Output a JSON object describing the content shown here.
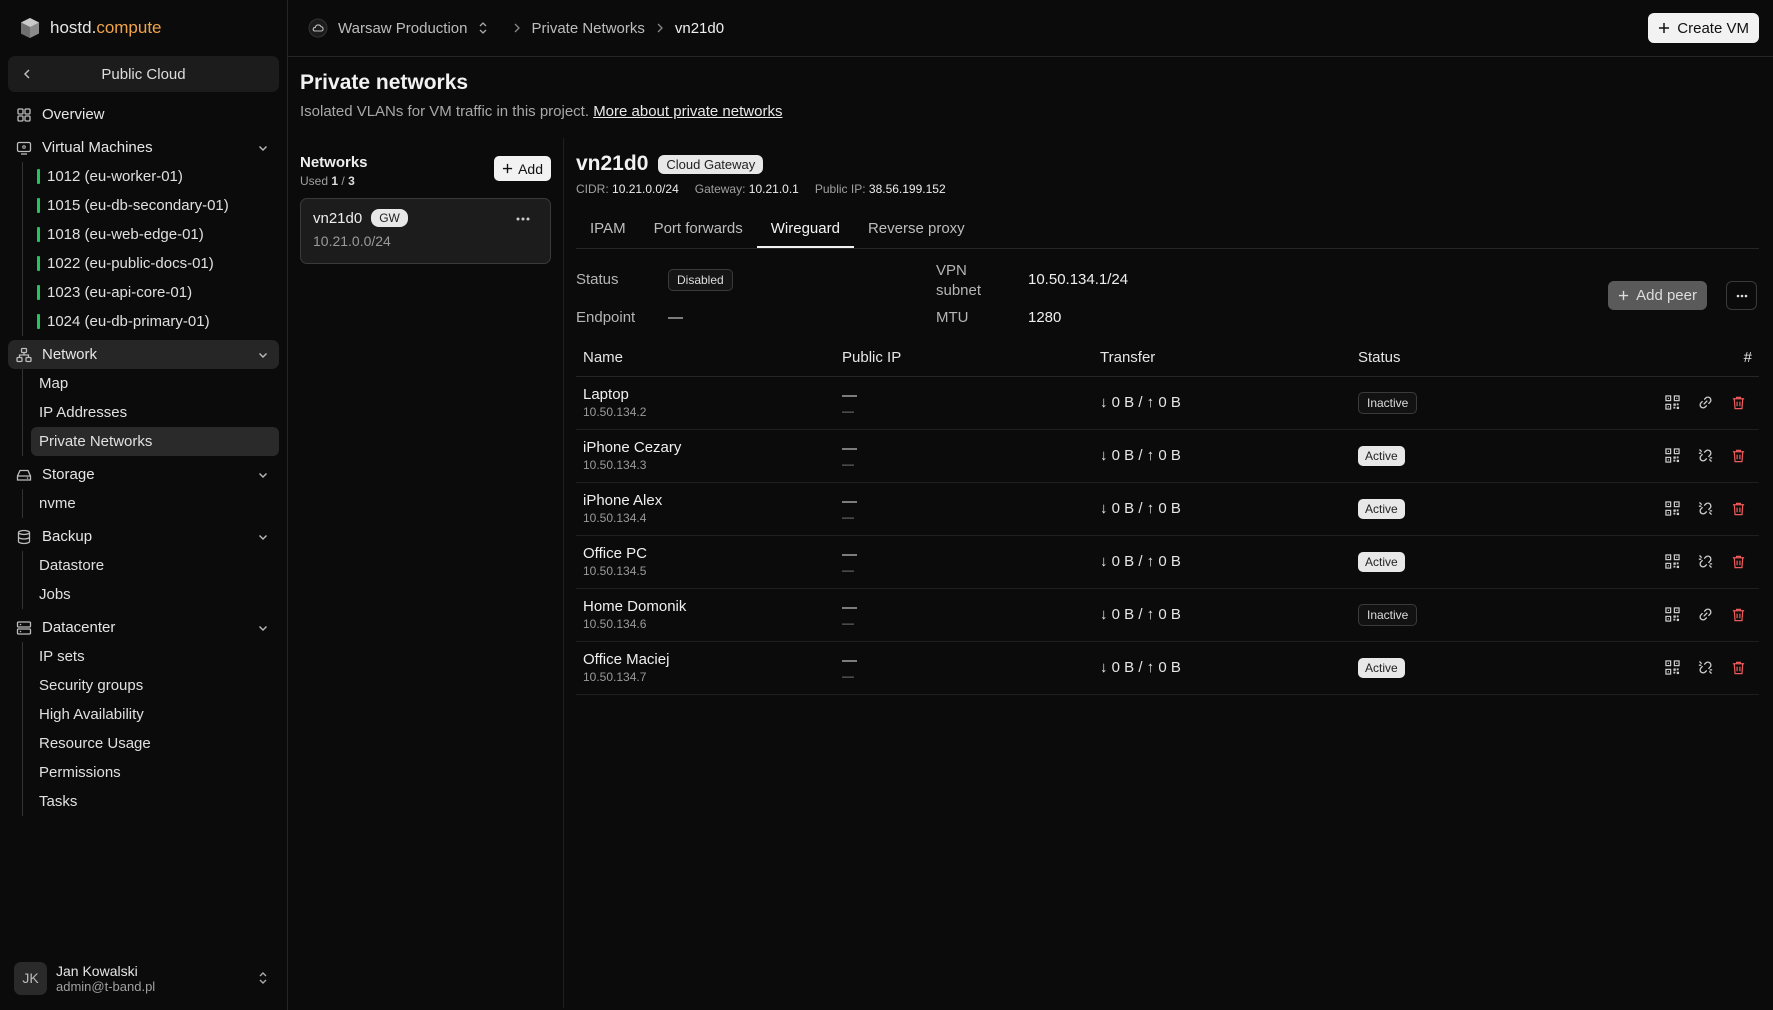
{
  "brand": {
    "name": "hostd.",
    "accent": "compute"
  },
  "sidebar": {
    "back_label": "Public Cloud",
    "overview": "Overview",
    "vm_group": "Virtual Machines",
    "vms": [
      "1012 (eu-worker-01)",
      "1015 (eu-db-secondary-01)",
      "1018 (eu-web-edge-01)",
      "1022 (eu-public-docs-01)",
      "1023 (eu-api-core-01)",
      "1024 (eu-db-primary-01)"
    ],
    "network_group": "Network",
    "network_items": [
      "Map",
      "IP Addresses",
      "Private Networks"
    ],
    "storage_group": "Storage",
    "storage_items": [
      "nvme"
    ],
    "backup_group": "Backup",
    "backup_items": [
      "Datastore",
      "Jobs"
    ],
    "datacenter_group": "Datacenter",
    "datacenter_items": [
      "IP sets",
      "Security groups",
      "High Availability",
      "Resource Usage",
      "Permissions",
      "Tasks"
    ]
  },
  "user": {
    "initials": "JK",
    "name": "Jan Kowalski",
    "email": "admin@t-band.pl"
  },
  "topbar": {
    "project": "Warsaw Production",
    "crumb1": "Private Networks",
    "crumb2": "vn21d0",
    "create_label": "Create VM"
  },
  "page": {
    "title": "Private networks",
    "subtitle": "Isolated VLANs for VM traffic in this project.",
    "link": "More about private networks"
  },
  "networks": {
    "title": "Networks",
    "used_label": "Used",
    "used": "1",
    "total": "3",
    "add_label": "Add",
    "card": {
      "name": "vn21d0",
      "badge": "GW",
      "cidr": "10.21.0.0/24"
    }
  },
  "detail": {
    "name": "vn21d0",
    "badge": "Cloud Gateway",
    "cidr_label": "CIDR:",
    "cidr": "10.21.0.0/24",
    "gateway_label": "Gateway:",
    "gateway": "10.21.0.1",
    "public_ip_label": "Public IP:",
    "public_ip": "38.56.199.152",
    "tabs": [
      "IPAM",
      "Port forwards",
      "Wireguard",
      "Reverse proxy"
    ],
    "active_tab": "Wireguard"
  },
  "wireguard": {
    "status_label": "Status",
    "status": "Disabled",
    "endpoint_label": "Endpoint",
    "endpoint": "—",
    "vpn_label_1": "VPN",
    "vpn_label_2": "subnet",
    "vpn_subnet": "10.50.134.1/24",
    "mtu_label": "MTU",
    "mtu": "1280",
    "add_peer_label": "Add peer",
    "columns": [
      "Name",
      "Public IP",
      "Transfer",
      "Status",
      "#"
    ],
    "peers": [
      {
        "name": "Laptop",
        "ip": "10.50.134.2",
        "public_ip": "—",
        "public_ip_sub": "—",
        "transfer": "↓ 0 B / ↑ 0 B",
        "status": "Inactive"
      },
      {
        "name": "iPhone Cezary",
        "ip": "10.50.134.3",
        "public_ip": "—",
        "public_ip_sub": "—",
        "transfer": "↓ 0 B / ↑ 0 B",
        "status": "Active"
      },
      {
        "name": "iPhone Alex",
        "ip": "10.50.134.4",
        "public_ip": "—",
        "public_ip_sub": "—",
        "transfer": "↓ 0 B / ↑ 0 B",
        "status": "Active"
      },
      {
        "name": "Office PC",
        "ip": "10.50.134.5",
        "public_ip": "—",
        "public_ip_sub": "—",
        "transfer": "↓ 0 B / ↑ 0 B",
        "status": "Active"
      },
      {
        "name": "Home Domonik",
        "ip": "10.50.134.6",
        "public_ip": "—",
        "public_ip_sub": "—",
        "transfer": "↓ 0 B / ↑ 0 B",
        "status": "Inactive"
      },
      {
        "name": "Office Maciej",
        "ip": "10.50.134.7",
        "public_ip": "—",
        "public_ip_sub": "—",
        "transfer": "↓ 0 B / ↑ 0 B",
        "status": "Active"
      }
    ]
  },
  "colors": {
    "accent": "#f0a44a",
    "vm_status": "#22c55e",
    "delete": "#ef5b5b"
  }
}
